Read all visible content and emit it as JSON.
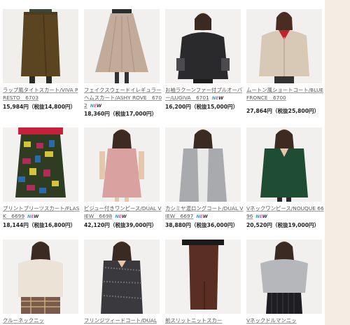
{
  "new_badge": [
    "N",
    "E",
    "W"
  ],
  "products": [
    {
      "title": "ラップ風タイトスカート/VIVA PRESTO　6703",
      "price": "15,984円（税抜14,800円）",
      "new": true
    },
    {
      "title": "フェイクスウェードイレギュラーヘムスカート/ASHY ROVE　6702",
      "price": "18,360円（税抜17,000円）",
      "new": true
    },
    {
      "title": "お袖ラクーンファー付プルオーバー/LUGIVA　6701",
      "price": "16,200円（税抜15,000円）",
      "new": true
    },
    {
      "title": "ムートン風ショートコート/BLUE FRONCE　6700",
      "price": "27,864円（税抜25,800円）",
      "new": true
    },
    {
      "title": "プリントプリーツスカート/FLASK　6699",
      "price": "18,144円（税抜16,800円）",
      "new": true
    },
    {
      "title": "ビジュー付きワンピース/DUAL VIEW　6698",
      "price": "42,120円（税抜39,000円）",
      "new": true
    },
    {
      "title": "カシミヤ混ロングコート/DUAL VIEW　6697",
      "price": "38,880円（税抜36,000円）",
      "new": true
    },
    {
      "title": "Vネックワンピース/NOUQUE 6696",
      "price": "20,520円（税抜19,000円）",
      "new": true
    },
    {
      "title": "クルーネックニッ",
      "price": "",
      "new": false
    },
    {
      "title": "フリンジツィードコート/DUAL",
      "price": "",
      "new": false
    },
    {
      "title": "前スリットニットスカー",
      "price": "",
      "new": false
    },
    {
      "title": "Vネックドルマンニッ",
      "price": "",
      "new": false
    }
  ]
}
